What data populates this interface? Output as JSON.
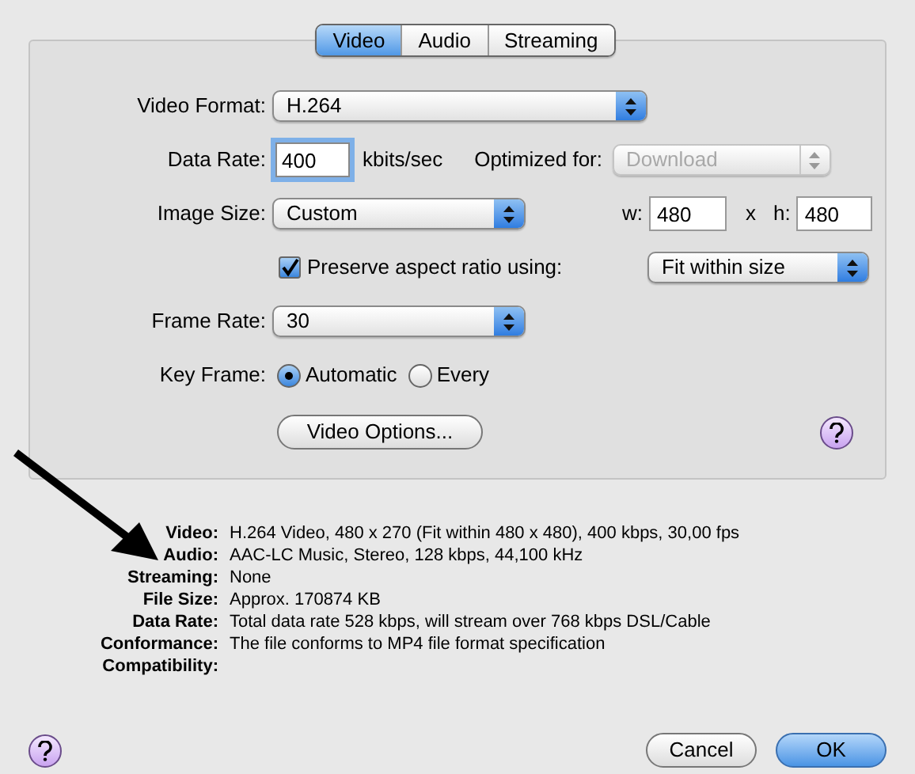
{
  "tabs": [
    {
      "label": "Video",
      "selected": true
    },
    {
      "label": "Audio",
      "selected": false
    },
    {
      "label": "Streaming",
      "selected": false
    }
  ],
  "rows": [
    {
      "kind": "select",
      "label": "Video Format:",
      "value": "H.264"
    },
    {
      "kind": "data_rate",
      "label": "Data Rate:",
      "value": "400",
      "focused": true,
      "unit": "kbits/sec",
      "optimized": {
        "label": "Optimized for:",
        "value": "Download",
        "disabled": true
      }
    },
    {
      "kind": "image_size",
      "label": "Image Size:",
      "value": "Custom",
      "width": {
        "label": "w:",
        "value": "480"
      },
      "separator": "x",
      "height": {
        "label": "h:",
        "value": "480"
      }
    },
    {
      "kind": "checkbox",
      "label": "Preserve aspect ratio using:",
      "checked": true,
      "value": "Fit within size"
    },
    {
      "kind": "select",
      "label": "Frame Rate:",
      "value": "30"
    },
    {
      "kind": "radios",
      "label": "Key Frame:",
      "options": [
        {
          "label": "Automatic",
          "selected": true
        },
        {
          "label": "Every",
          "selected": false
        }
      ]
    },
    {
      "kind": "button",
      "label": "Video Options..."
    }
  ],
  "summary": [
    {
      "label": "Video:",
      "value": "H.264 Video, 480 x 270 (Fit within 480 x 480), 400 kbps, 30,00 fps"
    },
    {
      "label": "Audio:",
      "value": "AAC-LC Music, Stereo, 128 kbps, 44,100 kHz"
    },
    {
      "label": "Streaming:",
      "value": "None"
    },
    {
      "label": "File Size:",
      "value": "Approx. 170874 KB"
    },
    {
      "label": "Data Rate:",
      "value": "Total data rate 528 kbps, will stream over 768 kbps DSL/Cable"
    },
    {
      "label": "Conformance:",
      "value": "The file conforms to MP4 file format specification"
    },
    {
      "label": "Compatibility:"
    }
  ],
  "buttons": [
    {
      "label": "Cancel",
      "default": false
    },
    {
      "label": "OK",
      "default": true
    }
  ]
}
